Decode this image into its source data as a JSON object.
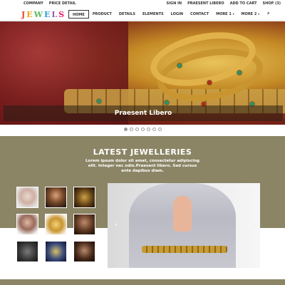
{
  "topbar": {
    "left": [
      "COMPANY",
      "PRICE DETAIL"
    ],
    "right": [
      "SIGN IN",
      "PRAESENT LIBERO",
      "ADD TO CART",
      "SHOP (3)"
    ]
  },
  "logo": {
    "letters": [
      "J",
      "E",
      "W",
      "E",
      "L",
      "S"
    ]
  },
  "menu": {
    "items": [
      "HOME",
      "PRODUCT",
      "DETAILS",
      "ELEMENTS",
      "LOGIN",
      "CONTACT",
      "MORE 1",
      "MORE 2"
    ],
    "active": "HOME",
    "caret": "▾",
    "search_icon": "⌕"
  },
  "hero": {
    "caption": "Praesent Libero"
  },
  "carousel": {
    "dot_count": 7,
    "active_index": 0
  },
  "latest": {
    "title": "LATEST JEWELLERIES",
    "subtitle": "Lorem ipsum dolor sit amet, consectetur adipiscing elit. Integer nec odio.Praesent libero. Sed cursus ante dapibus diam."
  },
  "slider": {
    "prev": "‹",
    "next": "›"
  },
  "colors": {
    "section_bg": "#8b8566",
    "accent_gold": "#d9a93a"
  }
}
